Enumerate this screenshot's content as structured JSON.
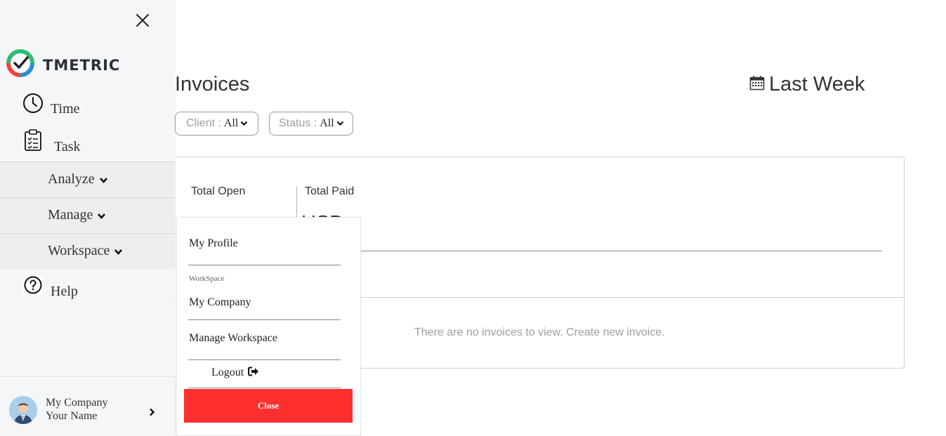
{
  "brand": {
    "name": "TMETRIC"
  },
  "sidebar": {
    "items": [
      {
        "label": "Time",
        "icon": "clock-icon"
      },
      {
        "label": "Task",
        "icon": "clipboard-icon"
      },
      {
        "label": "Analyze",
        "icon": "chevron-down-icon"
      },
      {
        "label": "Manage",
        "icon": "chevron-down-icon"
      },
      {
        "label": "Workspace",
        "icon": "chevron-down-icon"
      },
      {
        "label": "Help",
        "icon": "question-circle-icon"
      }
    ],
    "user": {
      "company": "My Company",
      "name": "Your Name"
    }
  },
  "main": {
    "title": "Invoices",
    "date_range": "Last Week",
    "filters": {
      "client": {
        "label": "Client :",
        "value": "All"
      },
      "status": {
        "label": "Status :",
        "value": "All"
      }
    },
    "summary": {
      "total_open_label": "Total Open",
      "total_paid_label": "Total Paid",
      "amount_suffix": "USD"
    },
    "empty_message": "There are no invoices to view. Create new invoice."
  },
  "menu": {
    "my_profile": "My Profile",
    "workspace_heading": "WorkSpace",
    "my_company": "My Company",
    "manage_workspace": "Manage Workspace",
    "logout": "Logout",
    "close": "Close"
  },
  "colors": {
    "close_button": "#ff2f2f",
    "sidebar_bg": "#f5f6f8"
  }
}
